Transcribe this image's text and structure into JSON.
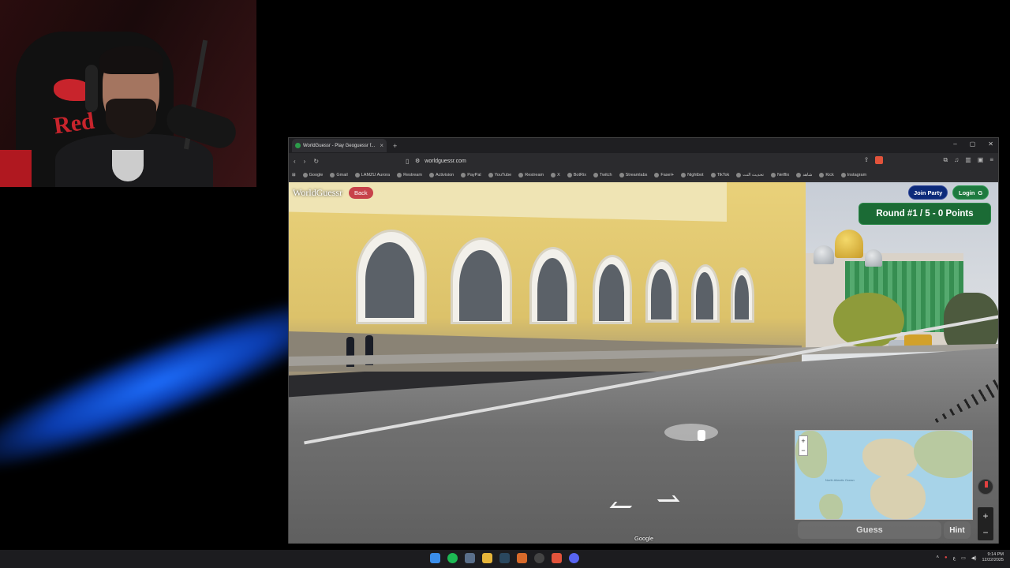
{
  "browser": {
    "tab_title": "WorldGuessr - Play Geoguessr f...",
    "new_tab": "+",
    "url": "worldguessr.com",
    "window_controls": [
      "–",
      "▢",
      "✕"
    ],
    "bookmarks": [
      "Google",
      "Gmail",
      "LAMZU Aurora",
      "Restream",
      "Activision",
      "PayPal",
      "YouTube",
      "Restream",
      "X",
      "BotRix",
      "Twitch",
      "Streamlabs",
      "Fasel+",
      "Nightbot",
      "TikTok",
      "تحديث النت",
      "Netflix",
      "شاهد",
      "Kick",
      "Instagram"
    ]
  },
  "game": {
    "site_name": "WorldGuessr",
    "back_label": "Back",
    "join_party_label": "Join Party",
    "login_label": "Login",
    "round_status": "Round #1 / 5 - 0 Points",
    "guess_label": "Guess",
    "hint_label": "Hint",
    "map_zoom_in": "+",
    "map_zoom_out": "−",
    "sv_zoom_in": "+",
    "sv_zoom_out": "−",
    "google_mark": "Google",
    "map_labels": [
      "North Atlantic Ocean"
    ]
  },
  "taskbar": {
    "time": "9:14 PM",
    "date": "12/22/2025",
    "lang": "ع"
  },
  "colors": {
    "back_button": "#c7424a",
    "join_party": "#0c2a7a",
    "login": "#1e7a3f",
    "round_pill": "#1b6b35"
  }
}
